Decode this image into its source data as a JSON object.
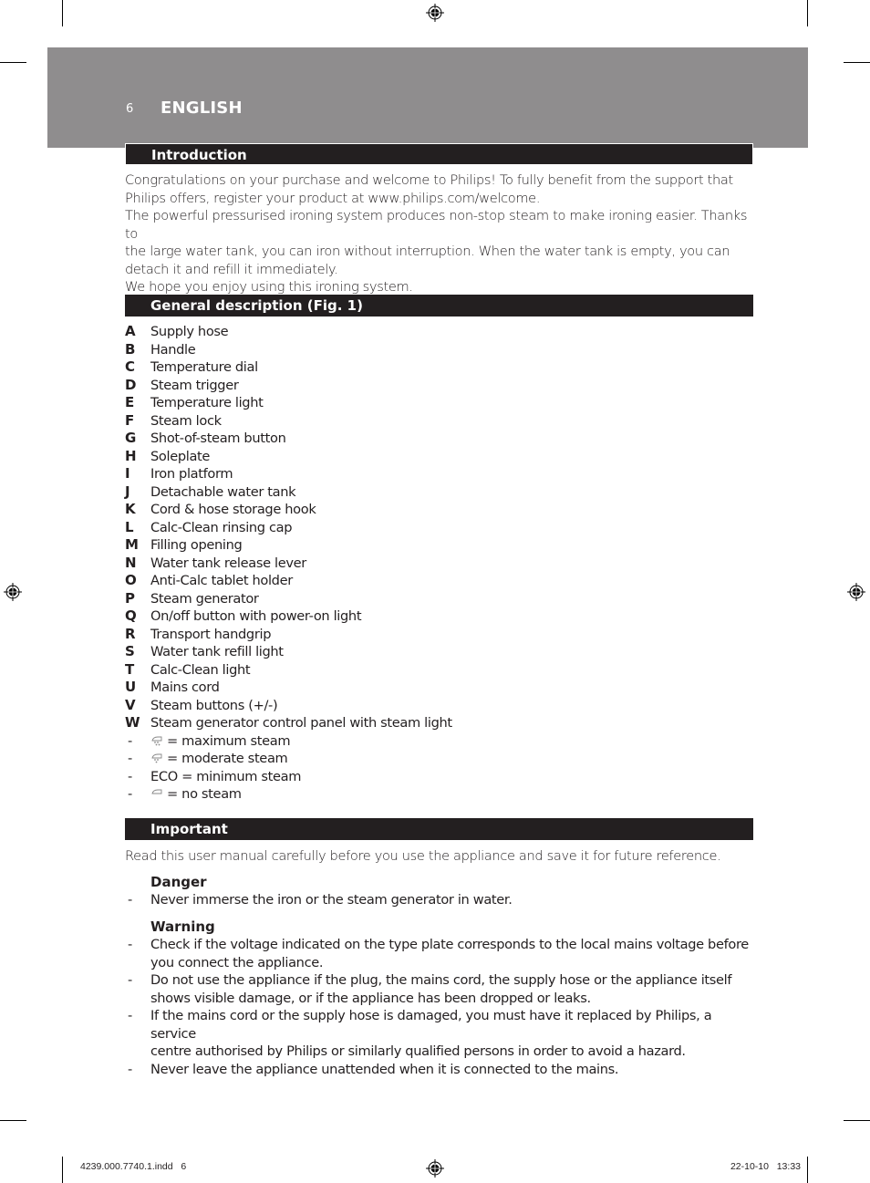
{
  "header": {
    "page_number": "6",
    "language": "ENGLISH"
  },
  "sections": {
    "introduction": {
      "title": "Introduction",
      "lines": [
        "Congratulations on your purchase and welcome to Philips! To fully benefit from the support that",
        "Philips offers, register your product at www.philips.com/welcome.",
        "The powerful pressurised ironing system produces non-stop steam to make ironing easier. Thanks to",
        "the large water tank, you can iron without interruption. When the water tank is empty, you can",
        "detach it and refill it immediately.",
        "We hope you enjoy using this ironing system."
      ]
    },
    "general_description": {
      "title": "General description (Fig. 1)",
      "items": [
        {
          "key": "A",
          "label": "Supply hose"
        },
        {
          "key": "B",
          "label": "Handle"
        },
        {
          "key": "C",
          "label": "Temperature dial"
        },
        {
          "key": "D",
          "label": "Steam trigger"
        },
        {
          "key": "E",
          "label": "Temperature light"
        },
        {
          "key": "F",
          "label": "Steam lock"
        },
        {
          "key": "G",
          "label": "Shot-of-steam button"
        },
        {
          "key": "H",
          "label": "Soleplate"
        },
        {
          "key": "I",
          "label": "Iron platform"
        },
        {
          "key": "J",
          "label": "Detachable water tank"
        },
        {
          "key": "K",
          "label": "Cord & hose storage hook"
        },
        {
          "key": "L",
          "label": "Calc-Clean rinsing cap"
        },
        {
          "key": "M",
          "label": "Filling opening"
        },
        {
          "key": "N",
          "label": "Water tank release lever"
        },
        {
          "key": "O",
          "label": "Anti-Calc tablet holder"
        },
        {
          "key": "P",
          "label": "Steam generator"
        },
        {
          "key": "Q",
          "label": "On/off button with power-on light"
        },
        {
          "key": "R",
          "label": "Transport handgrip"
        },
        {
          "key": "S",
          "label": "Water tank refill light"
        },
        {
          "key": "T",
          "label": "Calc-Clean light"
        },
        {
          "key": "U",
          "label": "Mains cord"
        },
        {
          "key": "V",
          "label": "Steam buttons (+/-)"
        },
        {
          "key": "W",
          "label": "Steam generator control panel with steam light"
        }
      ],
      "steam_settings": [
        {
          "dash": "-",
          "icon": "max-steam-icon",
          "text": "= maximum steam"
        },
        {
          "dash": "-",
          "icon": "moderate-steam-icon",
          "text": "= moderate steam"
        },
        {
          "dash": "-",
          "icon": "",
          "text": "ECO = minimum steam"
        },
        {
          "dash": "-",
          "icon": "no-steam-icon",
          "text": "= no steam"
        }
      ]
    },
    "important": {
      "title": "Important",
      "intro": "Read this user manual carefully before you use the appliance and save it for future reference.",
      "danger": {
        "title": "Danger",
        "items": [
          "Never immerse the iron or the steam generator in water."
        ]
      },
      "warning": {
        "title": "Warning",
        "items": [
          [
            "Check if the voltage indicated on the type plate corresponds to the local mains voltage before",
            "you connect the appliance."
          ],
          [
            "Do not use the appliance if the plug, the mains cord, the supply hose or the appliance itself",
            "shows visible damage, or if the appliance has been dropped or leaks."
          ],
          [
            "If the mains cord or the supply hose is damaged, you must have it replaced by Philips, a service",
            "centre authorised by Philips or similarly qualified persons in order to avoid a hazard."
          ],
          [
            "Never leave the appliance unattended when it is connected to the mains."
          ]
        ]
      }
    }
  },
  "footer": {
    "file": "4239.000.7740.1.indd   6",
    "timestamp": "22-10-10   13:33"
  },
  "colors": {
    "banner": "#8f8d8e",
    "heading_bar": "#231f20",
    "text": "#231f20"
  }
}
